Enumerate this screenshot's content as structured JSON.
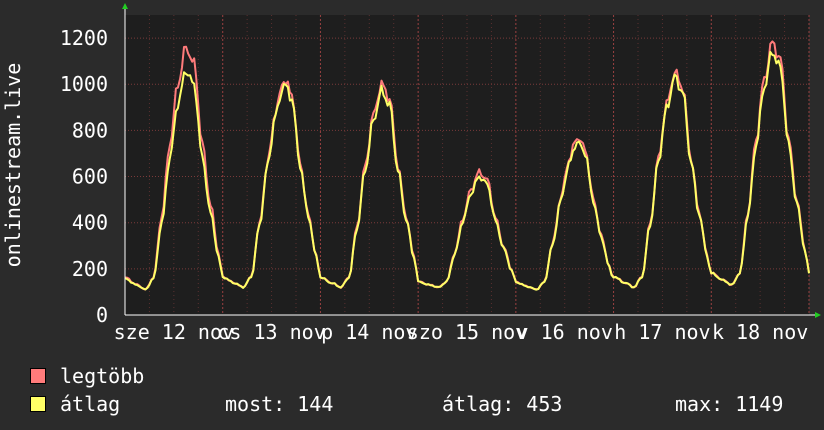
{
  "chart_data": {
    "type": "line",
    "ylabel": "onlinestream.live",
    "ylim": [
      0,
      1300
    ],
    "yticks": [
      0,
      200,
      400,
      600,
      800,
      1000,
      1200
    ],
    "xticks": [
      "sze 12 nov",
      "cs 13 nov",
      "p 14 nov",
      "szo 15 nov",
      "v 16 nov",
      "h 17 nov",
      "k 18 nov"
    ],
    "grid": true,
    "colors": {
      "legtobb": "#ff7b7b",
      "atlag": "#ffff66"
    },
    "days": 7,
    "profile": {
      "hours": [
        0,
        3,
        5,
        7,
        9,
        11,
        13,
        15,
        17,
        19,
        21,
        23,
        24
      ],
      "shape": [
        0.05,
        0.02,
        0,
        0.05,
        0.3,
        0.6,
        0.85,
        1,
        0.93,
        0.6,
        0.35,
        0.15,
        0.05
      ]
    },
    "series": [
      {
        "name": "legtöbb",
        "daily_min": [
          110,
          120,
          120,
          120,
          110,
          120,
          130
        ],
        "daily_peak": [
          1160,
          1020,
          1000,
          620,
          770,
          1050,
          1180
        ]
      },
      {
        "name": "átlag",
        "daily_min": [
          110,
          120,
          120,
          120,
          110,
          120,
          130
        ],
        "daily_peak": [
          1060,
          1000,
          970,
          600,
          750,
          1030,
          1140
        ]
      }
    ]
  },
  "legend": [
    {
      "label": "legtöbb",
      "color": "#ff7b7b"
    },
    {
      "label": "átlag",
      "color": "#ffff66"
    }
  ],
  "stats": {
    "most": "most: 144",
    "atlag": "átlag: 453",
    "max": "max: 1149"
  }
}
